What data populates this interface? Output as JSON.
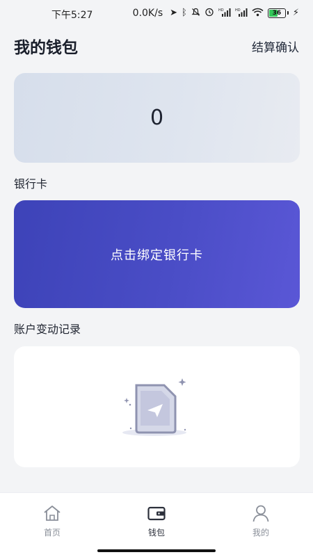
{
  "status_bar": {
    "time": "下午5:27",
    "network_speed": "0.0K/s",
    "battery_level": "36",
    "icons": [
      "location-arrow-icon",
      "bluetooth-icon",
      "mute-bell-icon",
      "alarm-icon",
      "hd-signal-icon",
      "hd-signal-icon",
      "wifi-icon",
      "battery-icon",
      "charging-icon"
    ]
  },
  "header": {
    "title": "我的钱包",
    "action_label": "结算确认"
  },
  "balance": {
    "value": "0"
  },
  "bank_section": {
    "label": "银行卡",
    "bind_card_label": "点击绑定银行卡"
  },
  "records_section": {
    "label": "账户变动记录",
    "empty_icon": "empty-document-icon"
  },
  "bottom_nav": {
    "items": [
      {
        "label": "首页",
        "icon": "home-icon",
        "active": false
      },
      {
        "label": "钱包",
        "icon": "wallet-icon",
        "active": true
      },
      {
        "label": "我的",
        "icon": "profile-icon",
        "active": false
      }
    ]
  },
  "colors": {
    "background": "#f3f4f6",
    "bank_card_start": "#3d43b8",
    "bank_card_end": "#5a57d6",
    "balance_card": "#dfe5ef"
  }
}
